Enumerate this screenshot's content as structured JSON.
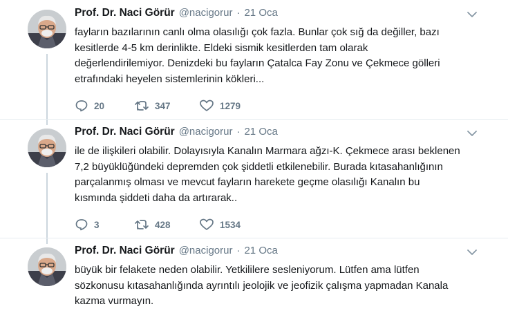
{
  "tweets": [
    {
      "author_name": "Prof. Dr. Naci Görür",
      "handle": "@nacigorur",
      "separator": "·",
      "date": "21 Oca",
      "text_lines": [
        "fayların bazılarının canlı olma olasılığı çok fazla. Bunlar çok sığ da değiller, bazı",
        "kesitlerde 4-5 km derinlikte. Eldeki sismik kesitlerden tam olarak",
        "değerlendirilemiyor. Denizdeki bu fayların Çatalca Fay Zonu ve Çekmece gölleri",
        "etrafındaki heyelen sistemlerinin kökleri..."
      ],
      "replies": "20",
      "retweets": "347",
      "likes": "1279"
    },
    {
      "author_name": "Prof. Dr. Naci Görür",
      "handle": "@nacigorur",
      "separator": "·",
      "date": "21 Oca",
      "text_lines": [
        "ile de ilişkileri olabilir. Dolayısıyla Kanalın Marmara ağzı-K. Çekmece arası beklenen",
        "7,2 büyüklüğündeki depremden çok şiddetli etkilenebilir. Burada kıtasahanlığının",
        "parçalanmış olması ve mevcut fayların harekete geçme olasılığı Kanalın bu",
        "kısmında şiddeti daha da artırarak.."
      ],
      "replies": "3",
      "retweets": "428",
      "likes": "1534"
    },
    {
      "author_name": "Prof. Dr. Naci Görür",
      "handle": "@nacigorur",
      "separator": "·",
      "date": "21 Oca",
      "text_lines": [
        "büyük bir felakete neden olabilir. Yetkililere sesleniyorum. Lütfen ama lütfen",
        "sözkonusu kıtasahanlığında ayrıntılı jeolojik ve jeofizik çalışma yapmadan Kanala",
        "kazma vurmayın."
      ]
    }
  ],
  "icons": {
    "reply": "reply-icon",
    "retweet": "retweet-icon",
    "like": "heart-icon",
    "menu": "chevron-down-icon"
  },
  "colors": {
    "text": "#14171a",
    "secondary": "#657786",
    "divider": "#e6ecf0",
    "thread_line": "#ccd6dd"
  }
}
